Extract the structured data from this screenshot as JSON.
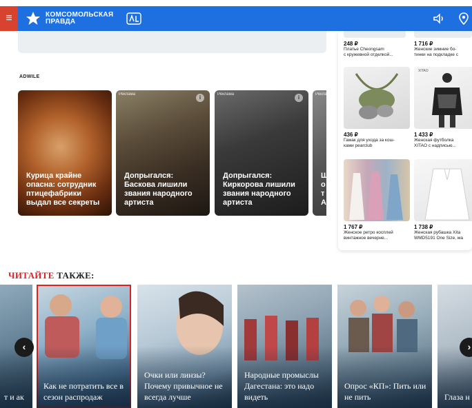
{
  "header": {
    "logo_line1": "КОМСОМОЛЬСКАЯ",
    "logo_line2": "ПРАВДА",
    "menu_icon": "hamburger-icon",
    "sound_icon": "speaker-icon",
    "geo_icon": "location-pin-icon",
    "color": "#1e6fe0",
    "menu_color": "#d8432f"
  },
  "ad_block": {
    "brand": "ADWILE",
    "ad_badge": "Реклама",
    "cards": [
      {
        "text": "Курица крайне опасна: сотрудник птицефабрики выдал все секреты"
      },
      {
        "text": "Допрыгался: Баскова лишили звания народного артиста"
      },
      {
        "text": "Допрыгался: Киркорова лишили звания народного артиста"
      },
      {
        "text": "Ш о т А"
      }
    ]
  },
  "products": [
    {
      "price": "248 ₽",
      "name1": "Платье Cheongsam",
      "name2": "с кружевной отделкой..."
    },
    {
      "price": "1 716 ₽",
      "name1": "Женские зимние бо-",
      "name2": "тинки на подкладке с"
    },
    {
      "price": "436 ₽",
      "name1": "Гамак для ухода за кош-",
      "name2": "ками pearclub"
    },
    {
      "price": "1 433 ₽",
      "name1": "Женская футболка",
      "name2": "XITAO с надписью..."
    },
    {
      "price": "1 767 ₽",
      "name1": "Женское ретро косплей",
      "name2": "винтажное вечерне..."
    },
    {
      "price": "1 738 ₽",
      "name1": "Женская рубашка Xita",
      "name2": "WMD5191 One Size, ма"
    }
  ],
  "product_brand_tag": "XITAO",
  "read_also": {
    "title_red": "ЧИТАЙТЕ",
    "title_dark": "ТАКЖЕ:",
    "prev": "‹",
    "next": "›",
    "articles": [
      {
        "text": "т и ак"
      },
      {
        "text": "Как не потратить все в сезон распродаж"
      },
      {
        "text": "Очки или линзы? Почему привычное не всегда лучше"
      },
      {
        "text": "Народные промыслы Дагестана: это надо видеть"
      },
      {
        "text": "Опрос «КП»: Пить или не пить"
      },
      {
        "text": "Глаза н сегодн завтра"
      }
    ]
  }
}
